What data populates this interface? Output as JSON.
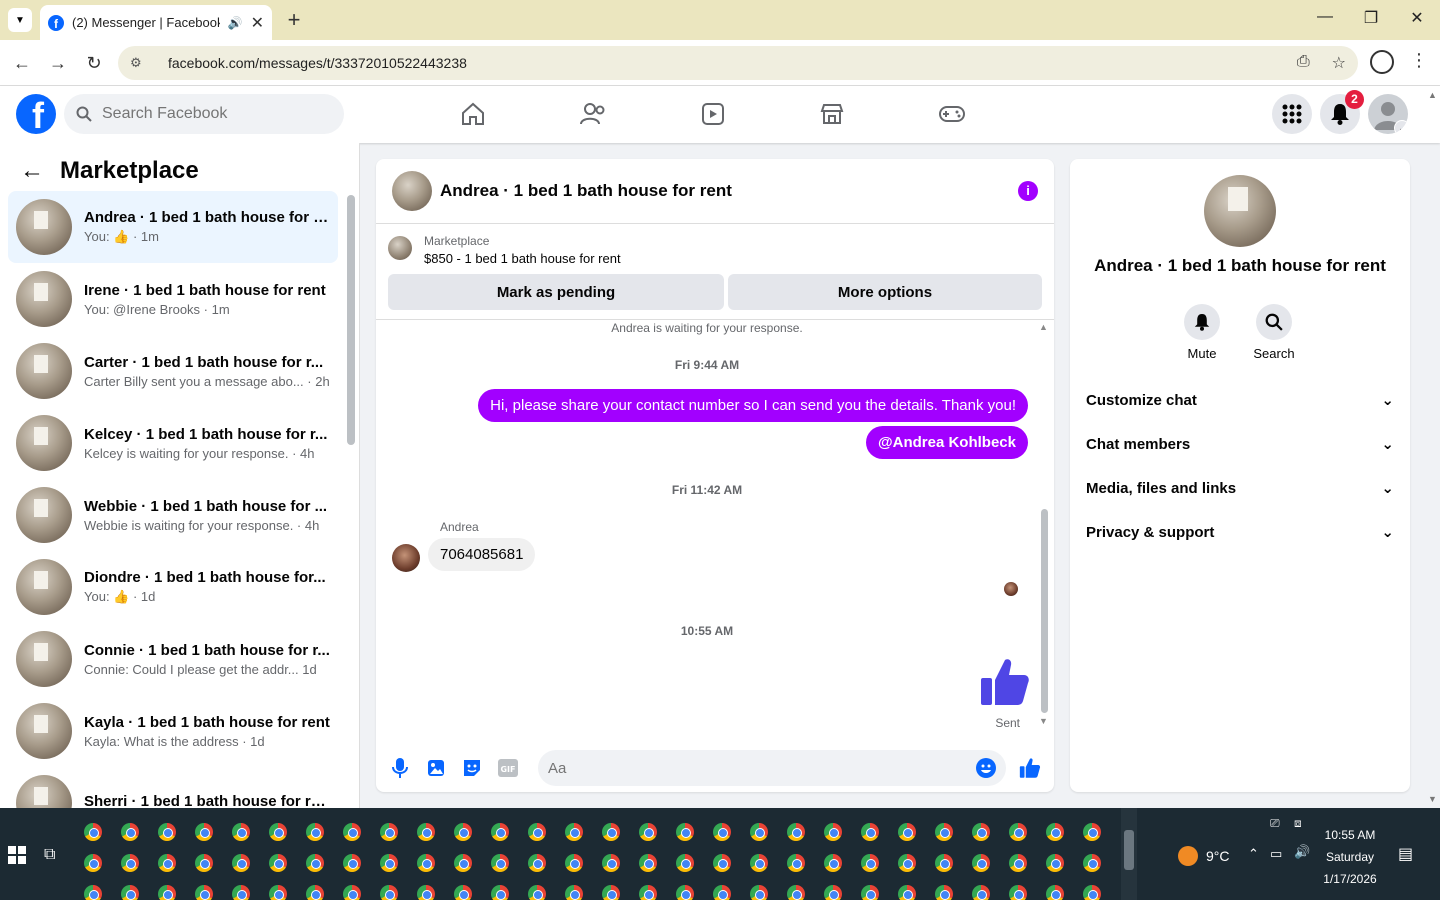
{
  "browser": {
    "tab_title": "(2) Messenger | Facebook",
    "url": "facebook.com/messages/t/33372010522443238"
  },
  "fb": {
    "search_placeholder": "Search Facebook",
    "notification_count": "2"
  },
  "left": {
    "title": "Marketplace",
    "conversations": [
      {
        "name": "Andrea · 1 bed 1 bath house for r...",
        "preview": "You: 👍 · 1m",
        "active": true
      },
      {
        "name": "Irene · 1 bed 1 bath house for rent",
        "preview": "You: @Irene Brooks · 1m"
      },
      {
        "name": "Carter · 1 bed 1 bath house for r...",
        "preview": "Carter Billy sent you a message abo... · 2h"
      },
      {
        "name": "Kelcey · 1 bed 1 bath house for r...",
        "preview": "Kelcey is waiting for your response. · 4h"
      },
      {
        "name": "Webbie · 1 bed 1 bath house for ...",
        "preview": "Webbie is waiting for your response. · 4h"
      },
      {
        "name": "Diondre · 1 bed 1 bath house for...",
        "preview": "You: 👍 · 1d"
      },
      {
        "name": "Connie · 1 bed 1 bath house for r...",
        "preview": "Connie: Could I please get the addr... 1d"
      },
      {
        "name": "Kayla · 1 bed 1 bath house for rent",
        "preview": "Kayla: What is the address · 1d"
      },
      {
        "name": "Sherri · 1 bed 1 bath house for re...",
        "preview": ""
      }
    ]
  },
  "chat": {
    "title": "Andrea · 1 bed 1 bath house for rent",
    "market_label": "Marketplace",
    "listing": "$850 - 1 bed 1 bath house for rent",
    "mark_pending": "Mark as pending",
    "more_options": "More options",
    "waiting": "Andrea is waiting for your response.",
    "ts1": "Fri 9:44 AM",
    "msg1": "Hi, please share your contact number so I can send you the details. Thank you!",
    "msg2": "@Andrea Kohlbeck",
    "ts2": "Fri 11:42 AM",
    "sender": "Andrea",
    "msg3": "7064085681",
    "ts3": "10:55 AM",
    "sent": "Sent",
    "composer_placeholder": "Aa"
  },
  "right": {
    "name": "Andrea · 1 bed 1 bath house for rent",
    "mute": "Mute",
    "search": "Search",
    "sections": [
      "Customize chat",
      "Chat members",
      "Media, files and links",
      "Privacy & support"
    ]
  },
  "taskbar": {
    "temperature": "9°C",
    "time": "10:55 AM",
    "day": "Saturday",
    "date": "1/17/2026"
  },
  "colors": {
    "accent": "#a200ff",
    "fb_blue": "#0866ff",
    "like_blue": "#4f46e5"
  }
}
